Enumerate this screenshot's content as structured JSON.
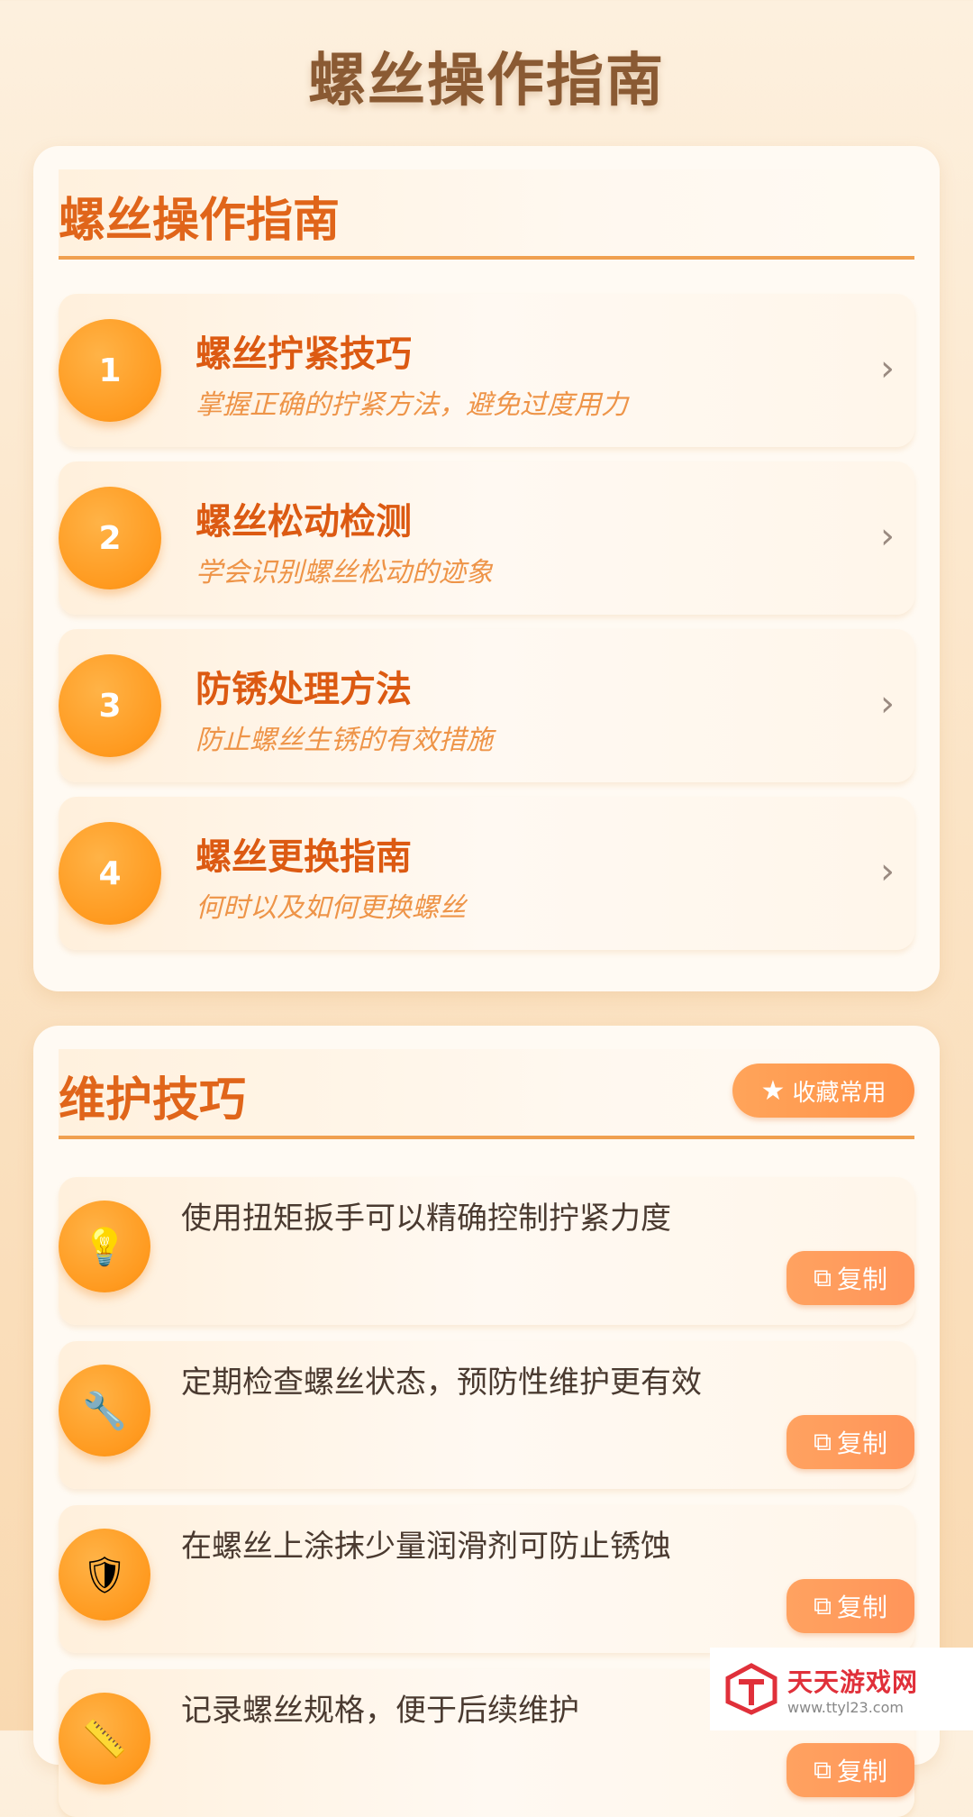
{
  "page": {
    "title": "螺丝操作指南"
  },
  "guide": {
    "title": "螺丝操作指南",
    "steps": [
      {
        "num": "1",
        "title": "螺丝拧紧技巧",
        "desc": "掌握正确的拧紧方法，避免过度用力"
      },
      {
        "num": "2",
        "title": "螺丝松动检测",
        "desc": "学会识别螺丝松动的迹象"
      },
      {
        "num": "3",
        "title": "防锈处理方法",
        "desc": "防止螺丝生锈的有效措施"
      },
      {
        "num": "4",
        "title": "螺丝更换指南",
        "desc": "何时以及如何更换螺丝"
      }
    ]
  },
  "tips": {
    "title": "维护技巧",
    "favorite_label": "收藏常用",
    "items": [
      {
        "icon": "lightbulb-icon",
        "text": "使用扭矩扳手可以精确控制拧紧力度",
        "copy_label": "复制"
      },
      {
        "icon": "wrench-icon",
        "text": "定期检查螺丝状态，预防性维护更有效",
        "copy_label": "复制"
      },
      {
        "icon": "shield-icon",
        "text": "在螺丝上涂抹少量润滑剂可防止锈蚀",
        "copy_label": "复制"
      },
      {
        "icon": "ruler-icon",
        "text": "记录螺丝规格，便于后续维护",
        "copy_label": "复制"
      }
    ]
  },
  "watermark": {
    "name": "天天游戏网",
    "url": "www.ttyl23.com"
  },
  "colors": {
    "accent": "#e0651a",
    "orange": "#ff9a1f",
    "background": "#fbe3c4"
  }
}
